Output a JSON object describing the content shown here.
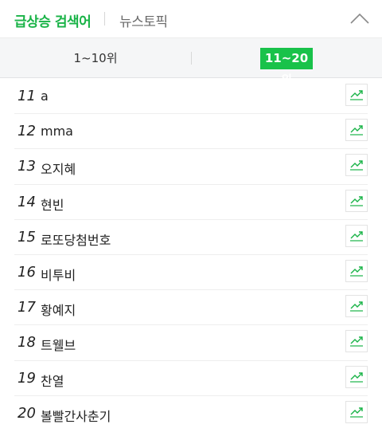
{
  "header": {
    "main_tab": "급상승 검색어",
    "news_tab": "뉴스토픽"
  },
  "range": {
    "first": "1~10위",
    "second": "11~20위",
    "selected": "11~20위"
  },
  "keywords": [
    {
      "rank": "11",
      "keyword": "a"
    },
    {
      "rank": "12",
      "keyword": "mma"
    },
    {
      "rank": "13",
      "keyword": "오지혜"
    },
    {
      "rank": "14",
      "keyword": "현빈"
    },
    {
      "rank": "15",
      "keyword": "로또당첨번호"
    },
    {
      "rank": "16",
      "keyword": "비투비"
    },
    {
      "rank": "17",
      "keyword": "황예지"
    },
    {
      "rank": "18",
      "keyword": "트웰브"
    },
    {
      "rank": "19",
      "keyword": "찬열"
    },
    {
      "rank": "20",
      "keyword": "볼빨간사춘기"
    }
  ],
  "icons": {
    "collapse": "chevron-up-icon",
    "trend": "trend-chart-icon"
  },
  "colors": {
    "accent": "#19b347",
    "selected_bg": "#19c24a"
  }
}
